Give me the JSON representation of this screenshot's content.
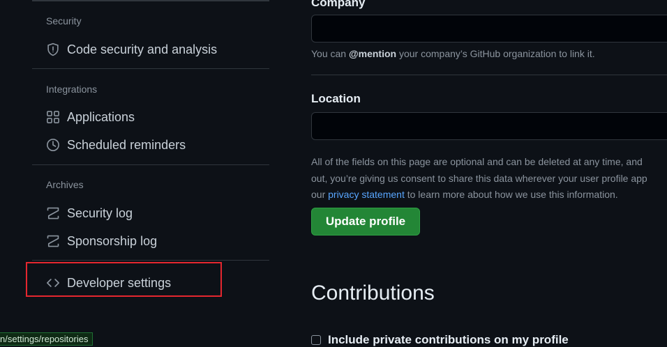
{
  "sidebar": {
    "security": {
      "heading": "Security",
      "items": [
        {
          "label": "Code security and analysis",
          "icon": "shield-icon"
        }
      ]
    },
    "integrations": {
      "heading": "Integrations",
      "items": [
        {
          "label": "Applications",
          "icon": "apps-grid-icon"
        },
        {
          "label": "Scheduled reminders",
          "icon": "clock-icon"
        }
      ]
    },
    "archives": {
      "heading": "Archives",
      "items": [
        {
          "label": "Security log",
          "icon": "log-icon"
        },
        {
          "label": "Sponsorship log",
          "icon": "log-icon"
        }
      ]
    },
    "developer": {
      "label": "Developer settings",
      "icon": "code-icon"
    }
  },
  "form": {
    "company": {
      "label": "Company",
      "value": "",
      "help_prefix": "You can ",
      "help_mention": "@mention",
      "help_suffix": " your company’s GitHub organization to link it."
    },
    "location": {
      "label": "Location",
      "value": ""
    },
    "disclaimer": {
      "line1": "All of the fields on this page are optional and can be deleted at any time, and",
      "line2": "out, you’re giving us consent to share this data wherever your user profile app",
      "line3_prefix": "our ",
      "line3_link": "privacy statement",
      "line3_suffix": " to learn more about how we use this information."
    },
    "update_button": "Update profile"
  },
  "contributions": {
    "title": "Contributions",
    "private_checkbox_label": "Include private contributions on my profile",
    "private_checked": false
  },
  "status_bar": {
    "url": "n/settings/repositories"
  },
  "colors": {
    "accent_green": "#238636",
    "link_blue": "#58a6ff",
    "highlight_red": "#e5272f"
  }
}
